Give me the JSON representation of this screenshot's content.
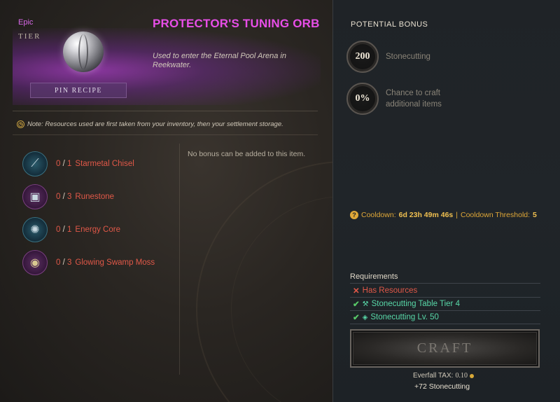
{
  "item": {
    "rarity": "Epic",
    "tier_label": "TIER",
    "title": "PROTECTOR'S TUNING ORB",
    "description": "Used to enter the Eternal Pool Arena in Reekwater.",
    "pin_recipe_label": "PIN RECIPE",
    "rarity_color": "#d868e8"
  },
  "note": {
    "icon": "clock-icon",
    "text": "Note: Resources used are first taken from your inventory, then your settlement storage."
  },
  "resources": [
    {
      "have": "0",
      "need": "1",
      "name": "Starmetal Chisel",
      "icon": "chisel-icon",
      "frame": "blue"
    },
    {
      "have": "0",
      "need": "3",
      "name": "Runestone",
      "icon": "runestone-icon",
      "frame": "purple"
    },
    {
      "have": "0",
      "need": "1",
      "name": "Energy Core",
      "icon": "energy-core-icon",
      "frame": "blue"
    },
    {
      "have": "0",
      "need": "3",
      "name": "Glowing Swamp Moss",
      "icon": "moss-icon",
      "frame": "purple"
    }
  ],
  "no_bonus_text": "No bonus can be added to this item.",
  "potential_bonus": {
    "title": "POTENTIAL BONUS",
    "skill_value": "200",
    "skill_label": "Stonecutting",
    "chance_value": "0%",
    "chance_label_1": "Chance to craft",
    "chance_label_2": "additional items"
  },
  "cooldown": {
    "label": "Cooldown:",
    "value": "6d 23h 49m 46s",
    "separator": "|",
    "threshold_label": "Cooldown Threshold:",
    "threshold_value": "5"
  },
  "requirements": {
    "title": "Requirements",
    "items": [
      {
        "text": "Has Resources",
        "met": false
      },
      {
        "text": "Stonecutting Table Tier 4",
        "met": true,
        "icon": "crafting-table-icon"
      },
      {
        "text": "Stonecutting Lv. 50",
        "met": true,
        "icon": "stonecutting-icon"
      }
    ]
  },
  "craft": {
    "button_label": "CRAFT",
    "tax_label": "Everfall TAX:",
    "tax_value": "0.10",
    "xp_text": "+72 Stonecutting"
  },
  "colors": {
    "missing_resource": "#e05848",
    "requirement_met": "#58d8a8",
    "cooldown": "#e0a838"
  }
}
